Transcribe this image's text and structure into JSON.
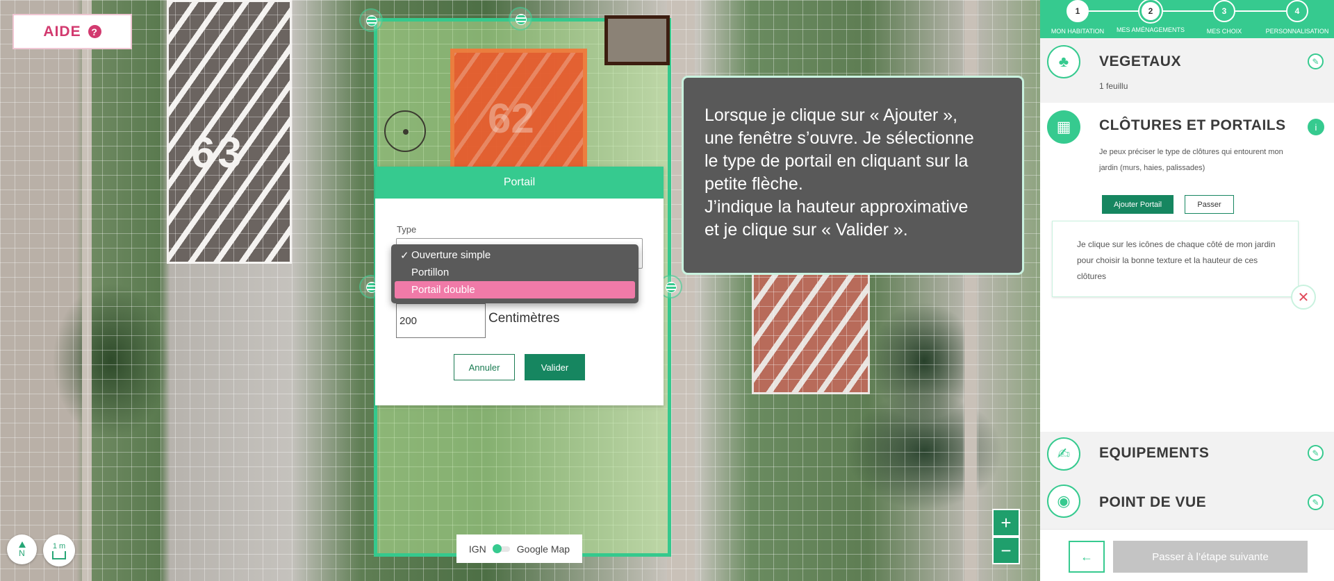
{
  "help_button": {
    "label": "AIDE",
    "icon": "question-icon"
  },
  "portail_modal": {
    "title": "Portail",
    "type_label": "Type",
    "options": [
      "Ouverture simple",
      "Portillon",
      "Portail double"
    ],
    "selected_option": "Ouverture simple",
    "highlighted_option": "Portail double",
    "height_value": "200",
    "height_unit": "Centimètres",
    "cancel_label": "Annuler",
    "confirm_label": "Valider"
  },
  "tooltip": {
    "text": "Lorsque je clique sur « Ajouter »,\nune fenêtre s’ouvre. Je sélectionne\nle type de portail en cliquant sur la\npetite flèche.\nJ’indique la hauteur approximative\net je clique sur « Valider »."
  },
  "map": {
    "house_numbers": [
      "63",
      "62"
    ],
    "compass_label": "N",
    "scale_label": "1 m",
    "layer_toggle": {
      "left": "IGN",
      "right": "Google Map"
    },
    "zoom_in": "+",
    "zoom_out": "−"
  },
  "stepper": {
    "steps": [
      {
        "number": "1",
        "label": "MON HABITATION"
      },
      {
        "number": "2",
        "label": "MES AMÉNAGEMENTS"
      },
      {
        "number": "3",
        "label": "MES CHOIX"
      },
      {
        "number": "4",
        "label": "PERSONNALISATION"
      }
    ],
    "current_step": 2
  },
  "sections": {
    "vegetaux": {
      "title": "VEGETAUX",
      "subtitle": "1 feuillu",
      "icon": "tree-icon"
    },
    "clotures": {
      "title": "CLÔTURES ET PORTAILS",
      "description": "Je peux préciser le type de clôtures qui entourent mon jardin (murs, haies, palissades)",
      "icon": "fence-icon",
      "add_button": "Ajouter Portail",
      "skip_button": "Passer",
      "help_text": "Je clique sur les icônes de chaque côté de mon jardin pour choisir la bonne texture et la hauteur de ces clôtures"
    },
    "equipements": {
      "title": "EQUIPEMENTS",
      "icon": "equipment-icon"
    },
    "point_de_vue": {
      "title": "POINT DE VUE",
      "icon": "eye-icon"
    }
  },
  "footer": {
    "back_icon": "arrow-left-icon",
    "next_label": "Passer à l’étape suivante"
  },
  "colors": {
    "accent": "#36ca8f",
    "dark_green": "#168660",
    "help_pink": "#d23a6f",
    "roof_orange": "#e75c2e",
    "tooltip_bg": "#595959",
    "highlight_pink": "#f07aa8"
  }
}
